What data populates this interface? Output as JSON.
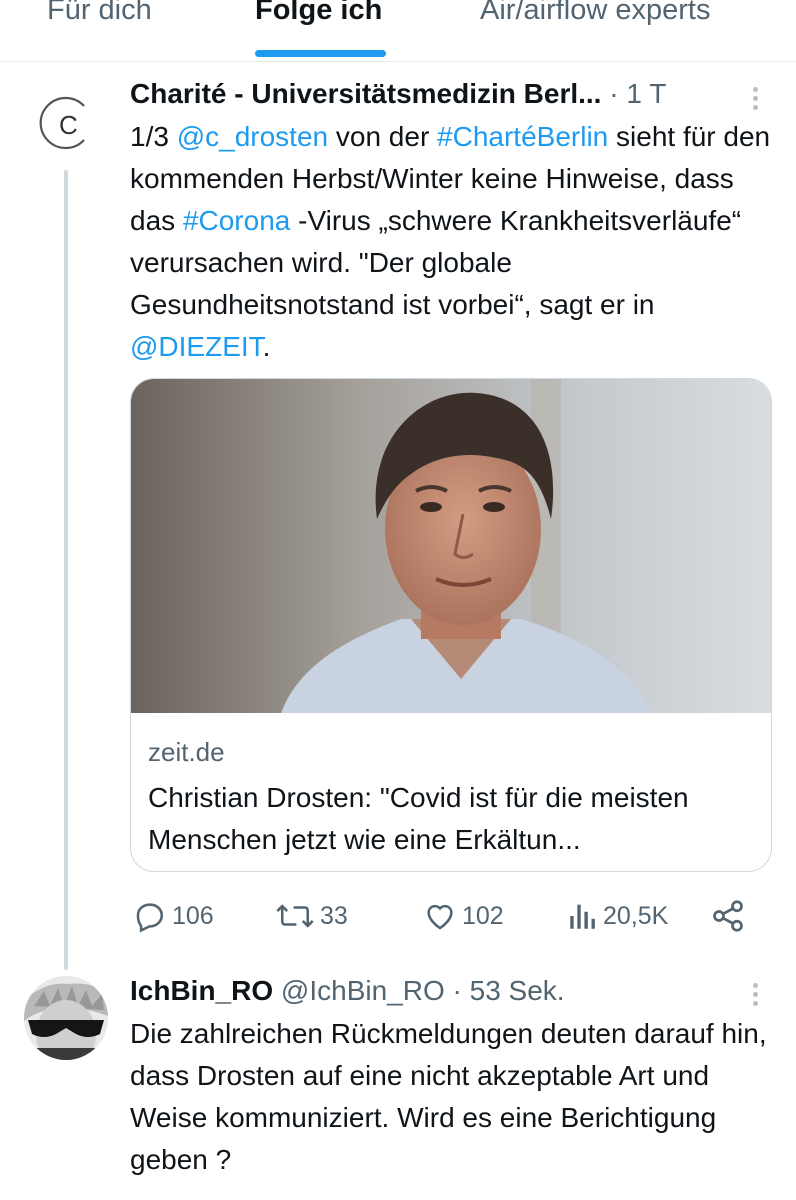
{
  "tabs": [
    {
      "label": "Für dich",
      "active": false
    },
    {
      "label": "Folge ich",
      "active": true
    },
    {
      "label": "Air/airflow experts",
      "active": false
    }
  ],
  "accent_color": "#1d9bf0",
  "tweet": {
    "author_name": "Charité - Universitätsmedizin Berl...",
    "time": "· 1 T",
    "avatar_icon": "charite-logo-icon",
    "text_parts": [
      {
        "text": "1/3 ",
        "link": false
      },
      {
        "text": "@c_drosten",
        "link": true
      },
      {
        "text": " von der ",
        "link": false
      },
      {
        "text": "#ChartéBerlin",
        "link": true
      },
      {
        "text": " sieht für den kommenden Herbst/Winter keine Hinweise, dass das ",
        "link": false
      },
      {
        "text": "#Corona",
        "link": true
      },
      {
        "text": " -Virus „schwere Krankheitsverläufe“ verursachen wird. \"Der globale Gesundheitsnotstand ist vorbei“, sagt er in ",
        "link": false
      },
      {
        "text": "@DIEZEIT",
        "link": true
      },
      {
        "text": ".",
        "link": false
      }
    ],
    "card": {
      "domain": "zeit.de",
      "title": "Christian Drosten: \"Covid ist für die meisten Menschen jetzt wie eine Erkältun..."
    },
    "actions": {
      "replies": "106",
      "retweets": "33",
      "likes": "102",
      "views": "20,5K"
    }
  },
  "reply": {
    "author_name": "IchBin_RO",
    "handle": "@IchBin_RO",
    "time": "· 53 Sek.",
    "text": "Die zahlreichen Rückmeldungen deuten darauf hin,  dass Drosten auf eine nicht akzeptable Art und Weise kommuniziert. Wird es eine Berichtigung geben ?"
  }
}
